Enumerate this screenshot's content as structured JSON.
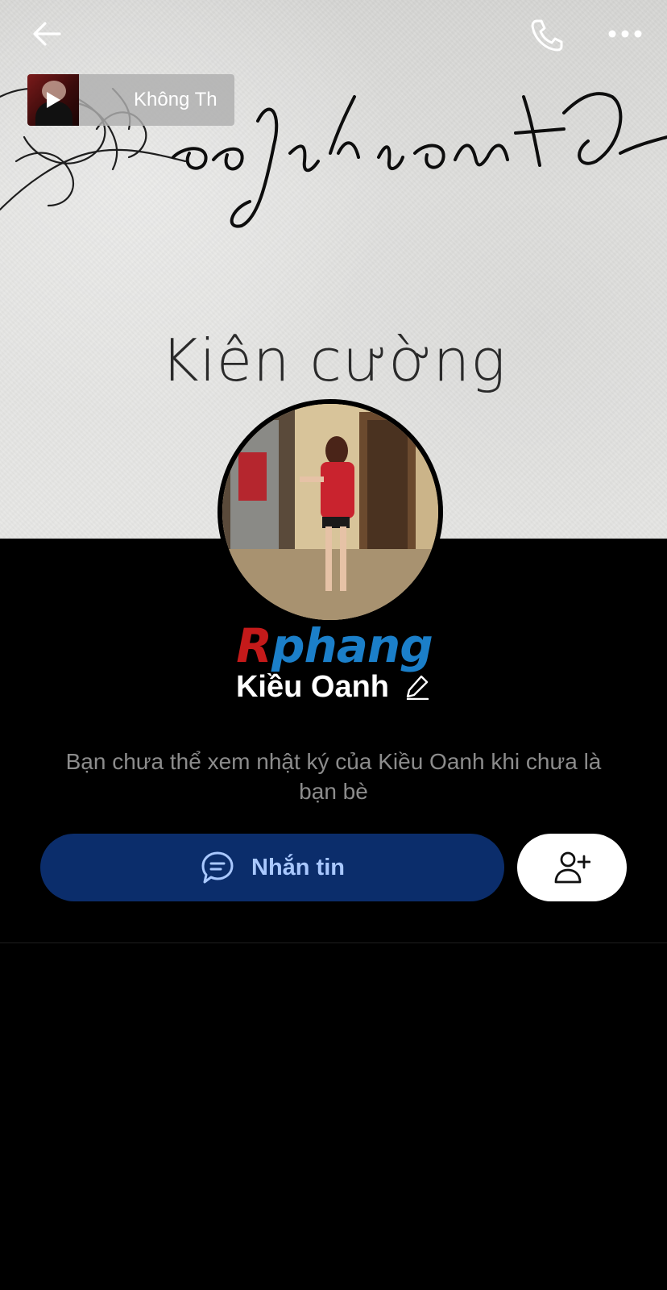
{
  "cover": {
    "script_text": "Resilient",
    "quote": "Kiên cường"
  },
  "topbar": {
    "back_icon": "arrow-left-icon",
    "call_icon": "phone-icon",
    "more_icon": "more-horizontal-icon"
  },
  "music": {
    "title": "Không Th",
    "play_icon": "play-icon"
  },
  "profile": {
    "watermark": {
      "first": "R",
      "rest": "phang"
    },
    "name": "Kiều Oanh",
    "edit_icon": "pencil-icon",
    "notice": "Bạn chưa thể xem nhật ký của Kiều Oanh khi chưa là bạn bè"
  },
  "actions": {
    "message_label": "Nhắn tin",
    "message_icon": "chat-bubble-icon",
    "add_friend_icon": "add-user-icon"
  },
  "colors": {
    "background": "#000000",
    "message_button": "#0b2d6b",
    "message_text": "#a9c8ff",
    "notice_text": "#8c8c8c"
  }
}
